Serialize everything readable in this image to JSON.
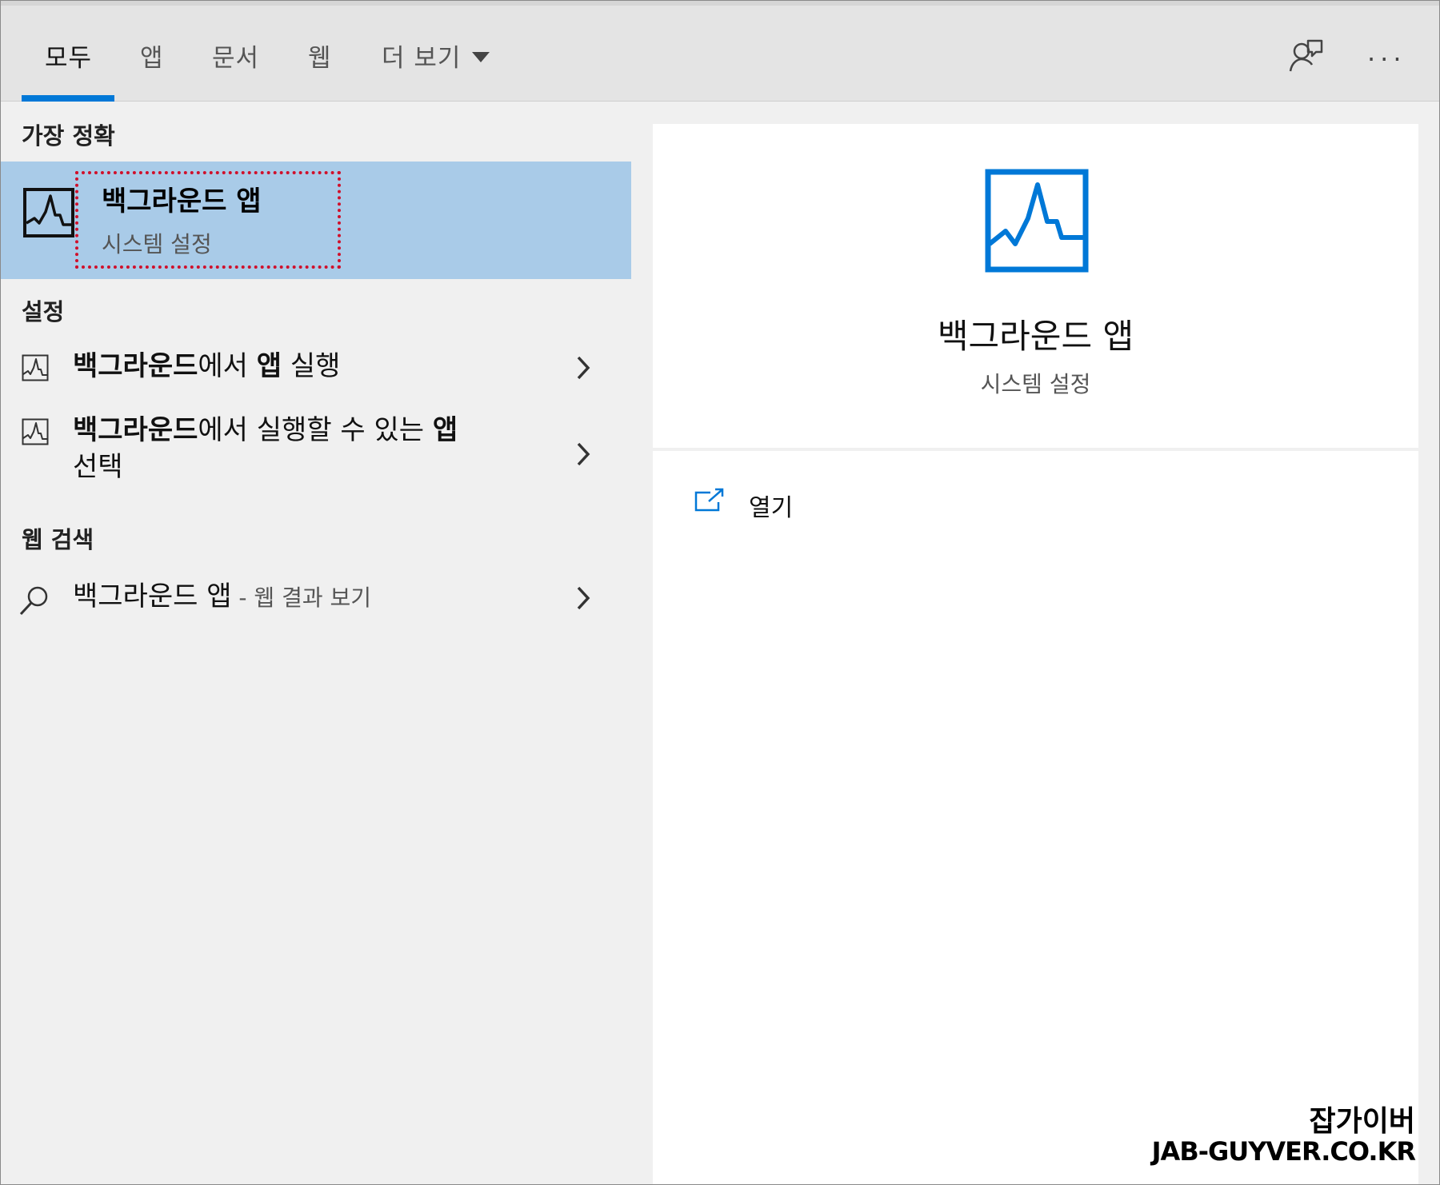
{
  "tabs": [
    {
      "label": "모두",
      "active": true
    },
    {
      "label": "앱",
      "active": false
    },
    {
      "label": "문서",
      "active": false
    },
    {
      "label": "웹",
      "active": false
    },
    {
      "label": "더 보기",
      "active": false
    }
  ],
  "toolbar": {
    "feedback_icon": "feedback-person-icon",
    "more_label": "···"
  },
  "sections": {
    "best_match": "가장 정확",
    "settings": "설정",
    "web_search": "웹 검색"
  },
  "best_match": {
    "title": "백그라운드 앱",
    "subtitle": "시스템 설정",
    "icon": "activity-chart-icon"
  },
  "settings_results": [
    {
      "bold1": "백그라운드",
      "normal1": "에서 ",
      "bold2": "앱",
      "normal2": " 실행"
    },
    {
      "bold1": "백그라운드",
      "normal1": "에서 실행할 수 있는 ",
      "bold2": "앱",
      "line2": "선택"
    }
  ],
  "web_result": {
    "query": "백그라운드 앱",
    "suffix": " - 웹 결과 보기"
  },
  "preview": {
    "title": "백그라운드 앱",
    "subtitle": "시스템 설정",
    "open_label": "열기"
  },
  "watermark": {
    "line1": "잡가이버",
    "line2": "JAB-GUYVER.CO.KR"
  },
  "colors": {
    "accent": "#0078d7",
    "selected_row": "#a9cbe8",
    "highlight_border": "#d0102b"
  }
}
